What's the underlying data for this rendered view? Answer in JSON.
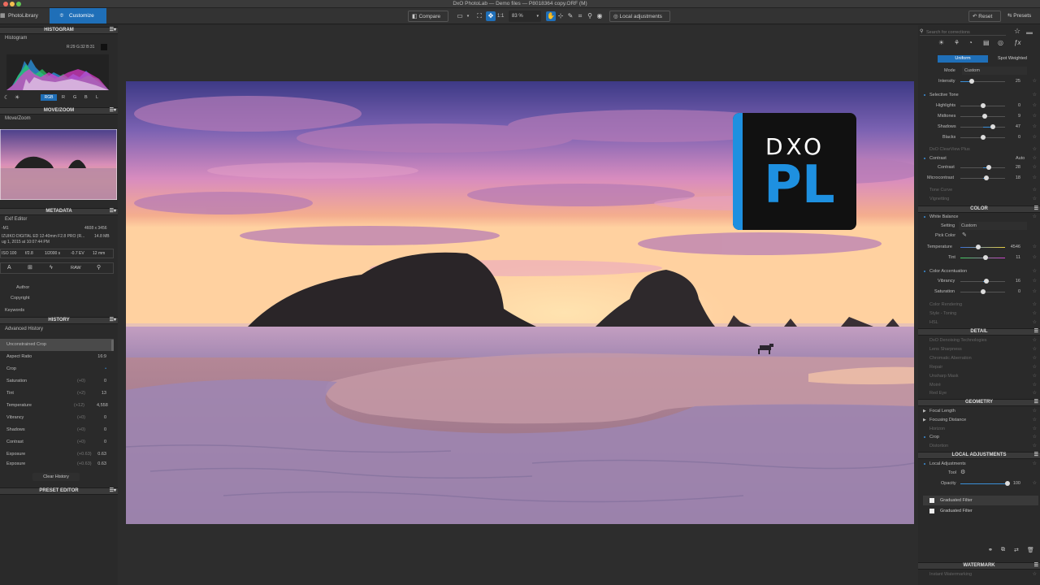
{
  "window": {
    "title": "DxO PhotoLab — Demo files — P8018364 copy.ORF (M)"
  },
  "tabs": {
    "photolibrary": "PhotoLibrary",
    "customize": "Customize"
  },
  "toolbar": {
    "compare": "Compare",
    "zoom_one": "1:1",
    "zoom_value": "83 %",
    "local_adjustments": "Local adjustments",
    "reset": "Reset",
    "presets": "Presets"
  },
  "histogram": {
    "header": "HISTOGRAM",
    "label": "Histogram",
    "readout": "R:29 G:32 B:31",
    "channels": [
      "RGB",
      "R",
      "G",
      "B",
      "L"
    ]
  },
  "movezoom": {
    "header": "MOVE/ZOOM",
    "label": "Move/Zoom"
  },
  "metadata": {
    "header": "METADATA",
    "editor": "Exif Editor",
    "camera": "-M1",
    "dims": "4608 x 3456",
    "lens": "IZUIKO DIGITAL ED 12-40mm F2.8 PRO (R...",
    "size": "14.8 MB",
    "date": "ug 1, 2015 at 10:07:44 PM",
    "exif": [
      "ISO 100",
      "f/2.8",
      "1/2000 s",
      "-0.7 EV",
      "12 mm"
    ],
    "raw": "RAW",
    "author": "Author",
    "copyright": "Copyright",
    "keywords": "Keywords"
  },
  "history": {
    "header": "HISTORY",
    "label": "Advanced History",
    "items": [
      {
        "name": "Unconstrained Crop",
        "delta": "",
        "value": ""
      },
      {
        "name": "Aspect Ratio",
        "delta": "",
        "value": "16:9"
      },
      {
        "name": "Crop",
        "delta": "",
        "value": "•"
      },
      {
        "name": "Saturation",
        "delta": "(+0)",
        "value": "0"
      },
      {
        "name": "Tint",
        "delta": "(+2)",
        "value": "13"
      },
      {
        "name": "Temperature",
        "delta": "(+12)",
        "value": "4,558"
      },
      {
        "name": "Vibrancy",
        "delta": "(+0)",
        "value": "0"
      },
      {
        "name": "Shadows",
        "delta": "(+0)",
        "value": "0"
      },
      {
        "name": "Contrast",
        "delta": "(+0)",
        "value": "0"
      },
      {
        "name": "Exposure",
        "delta": "(+0.63)",
        "value": "0.63"
      },
      {
        "name": "Exposure",
        "delta": "(+0.63)",
        "value": "0.63"
      }
    ],
    "clear": "Clear History"
  },
  "preset_editor": {
    "header": "PRESET EDITOR"
  },
  "logo": {
    "top": "DXO",
    "bottom": "PL"
  },
  "right": {
    "search_placeholder": "Search for corrections",
    "uniform": "Uniform",
    "spot_weighted": "Spot Weighted",
    "mode_label": "Mode",
    "mode_value": "Custom",
    "intensity_label": "Intensity",
    "intensity_value": "25",
    "selective_tone": "Selective Tone",
    "highlights": "Highlights",
    "highlights_v": "0",
    "midtones": "Midtones",
    "midtones_v": "9",
    "shadows": "Shadows",
    "shadows_v": "47",
    "blacks": "Blacks",
    "blacks_v": "0",
    "clearview": "DxO ClearView Plus",
    "contrast_hdr": "Contrast",
    "contrast_auto": "Auto",
    "contrast": "Contrast",
    "contrast_v": "28",
    "microcontrast": "Microcontrast",
    "microcontrast_v": "18",
    "tone_curve": "Tone Curve",
    "vignetting": "Vignetting",
    "color_header": "COLOR",
    "white_balance": "White Balance",
    "setting_label": "Setting",
    "setting_value": "Custom",
    "pick_color": "Pick Color",
    "temperature": "Temperature",
    "temperature_v": "4546",
    "tint": "Tint",
    "tint_v": "11",
    "color_accentuation": "Color Accentuation",
    "vibrancy": "Vibrancy",
    "vibrancy_v": "16",
    "saturation": "Saturation",
    "saturation_v": "0",
    "color_rendering": "Color Rendering",
    "style_toning": "Style - Toning",
    "hsl": "HSL",
    "detail_header": "DETAIL",
    "denoising": "DxO Denoising Technologies",
    "lens_sharpness": "Lens Sharpness",
    "chromatic": "Chromatic Aberration",
    "repair": "Repair",
    "unsharp": "Unsharp Mask",
    "moire": "Moiré",
    "red_eye": "Red Eye",
    "geometry_header": "GEOMETRY",
    "focal_length": "Focal Length",
    "focusing_distance": "Focusing Distance",
    "horizon": "Horizon",
    "crop": "Crop",
    "distortion": "Distortion",
    "local_header": "LOCAL ADJUSTMENTS",
    "local_adjustments": "Local Adjustments",
    "tool_label": "Tool",
    "opacity_label": "Opacity",
    "opacity_v": "100",
    "filter1": "Graduated Filter",
    "filter2": "Graduated Filter",
    "watermark_header": "WATERMARK",
    "instant_watermarking": "Instant Watermarking"
  }
}
